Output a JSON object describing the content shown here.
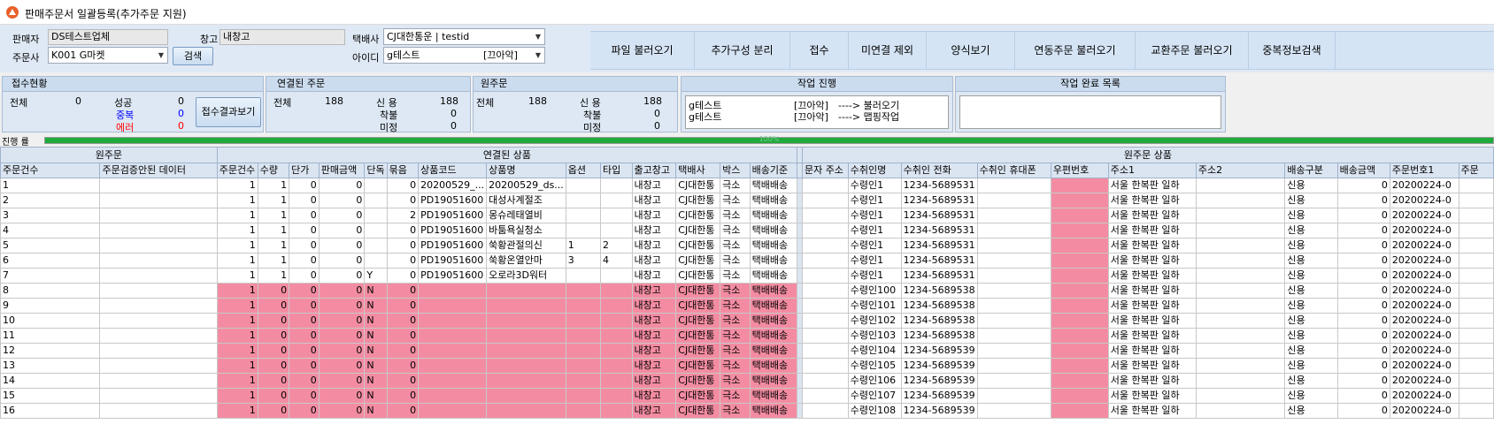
{
  "window": {
    "title": "판매주문서 일괄등록(추가주문 지원)"
  },
  "filters": {
    "seller_label": "판매자",
    "seller_value": "DS테스트업체",
    "warehouse_label": "창고",
    "warehouse_value": "내창고",
    "courier_label": "택배사",
    "courier_value": "CJ대한통운 | testid",
    "orderer_label": "주문사",
    "orderer_value": "K001 G마켓",
    "search_button": "검색",
    "id_label": "아이디",
    "id_value": "g테스트",
    "id_value_tag": "[끄아악]"
  },
  "toolbar": [
    "파일 불러오기",
    "추가구성 분리",
    "접수",
    "미연결 제외",
    "양식보기",
    "연동주문 불러오기",
    "교환주문 불러오기",
    "중복정보검색"
  ],
  "receipt": {
    "title": "접수현황",
    "total_label": "전체",
    "total": "0",
    "success_label": "성공",
    "success": "0",
    "dup_label": "중복",
    "dup": "0",
    "error_label": "에러",
    "error": "0",
    "button": "접수결과보기"
  },
  "linked": {
    "title": "연결된 주문",
    "total_label": "전체",
    "total": "188",
    "credit_label": "신 용",
    "credit": "188",
    "cod_label": "착불",
    "cod": "0",
    "undecided_label": "미정",
    "undecided": "0"
  },
  "original": {
    "title": "원주문",
    "total_label": "전체",
    "total": "188",
    "credit_label": "신 용",
    "credit": "188",
    "cod_label": "착불",
    "cod": "0",
    "undecided_label": "미정",
    "undecided": "0"
  },
  "progress_panel": {
    "title": "작업 진행",
    "lines": [
      {
        "name": "g테스트",
        "tag": "[끄아악]",
        "action": "----> 불러오기"
      },
      {
        "name": "g테스트",
        "tag": "[끄아악]",
        "action": "----> 맵핑작업"
      }
    ]
  },
  "done_panel": {
    "title": "작업 완료 목록"
  },
  "progress": {
    "label": "진행 률",
    "percent": 100,
    "text": "100%"
  },
  "colors": {
    "error_row": "#f38ca2",
    "header": "#dbe5f1",
    "progress": "#1faa3c",
    "dup": "#0000ff",
    "error": "#ff0000"
  },
  "grid": {
    "groups": {
      "original": "원주문",
      "linked": "연결된 상품",
      "original_product": "원주문 상품"
    },
    "left_headers": [
      "주문건수",
      "주문검증안된 데이터"
    ],
    "mid_headers": [
      "주문건수",
      "수량",
      "단가",
      "판매금액",
      "단독",
      "묶음",
      "상품코드",
      "상품명",
      "옵션",
      "타입",
      "출고창고",
      "택배사",
      "박스",
      "배송기준"
    ],
    "right_headers": [
      "문자 주소",
      "수취인명",
      "수취인 전화",
      "수취인 휴대폰",
      "우편번호",
      "주소1",
      "주소2",
      "배송구분",
      "배송금액",
      "주문번호1",
      "주문"
    ],
    "rows": [
      {
        "no": "1",
        "m": [
          "1",
          "1",
          "0",
          "0",
          "",
          "0",
          "20200529_...",
          "20200529_ds...",
          "",
          "",
          "내창고",
          "CJ대한통",
          "극소",
          "택배배송"
        ],
        "r": [
          "",
          "수령인1",
          "1234-5689531",
          "",
          "",
          "서울 한복판 일하",
          "",
          "신용",
          "0",
          "20200224-0",
          ""
        ],
        "err": false
      },
      {
        "no": "2",
        "m": [
          "1",
          "1",
          "0",
          "0",
          "",
          "0",
          "PD19051600",
          "대성사계절조",
          "",
          "",
          "내창고",
          "CJ대한통",
          "극소",
          "택배배송"
        ],
        "r": [
          "",
          "수령인1",
          "1234-5689531",
          "",
          "",
          "서울 한복판 일하",
          "",
          "신용",
          "0",
          "20200224-0",
          ""
        ],
        "err": false
      },
      {
        "no": "3",
        "m": [
          "1",
          "1",
          "0",
          "0",
          "",
          "2",
          "PD19051600",
          "몽슈레태열비",
          "",
          "",
          "내창고",
          "CJ대한통",
          "극소",
          "택배배송"
        ],
        "r": [
          "",
          "수령인1",
          "1234-5689531",
          "",
          "",
          "서울 한복판 일하",
          "",
          "신용",
          "0",
          "20200224-0",
          ""
        ],
        "err": false
      },
      {
        "no": "4",
        "m": [
          "1",
          "1",
          "0",
          "0",
          "",
          "0",
          "PD19051600",
          "바툼욕실청소",
          "",
          "",
          "내창고",
          "CJ대한통",
          "극소",
          "택배배송"
        ],
        "r": [
          "",
          "수령인1",
          "1234-5689531",
          "",
          "",
          "서울 한복판 일하",
          "",
          "신용",
          "0",
          "20200224-0",
          ""
        ],
        "err": false
      },
      {
        "no": "5",
        "m": [
          "1",
          "1",
          "0",
          "0",
          "",
          "0",
          "PD19051600",
          "쑥황관절의신",
          "1",
          "2",
          "내창고",
          "CJ대한통",
          "극소",
          "택배배송"
        ],
        "r": [
          "",
          "수령인1",
          "1234-5689531",
          "",
          "",
          "서울 한복판 일하",
          "",
          "신용",
          "0",
          "20200224-0",
          ""
        ],
        "err": false
      },
      {
        "no": "6",
        "m": [
          "1",
          "1",
          "0",
          "0",
          "",
          "0",
          "PD19051600",
          "쑥황온열안마",
          "3",
          "4",
          "내창고",
          "CJ대한통",
          "극소",
          "택배배송"
        ],
        "r": [
          "",
          "수령인1",
          "1234-5689531",
          "",
          "",
          "서울 한복판 일하",
          "",
          "신용",
          "0",
          "20200224-0",
          ""
        ],
        "err": false
      },
      {
        "no": "7",
        "m": [
          "1",
          "1",
          "0",
          "0",
          "Y",
          "0",
          "PD19051600",
          "오로라3D워터",
          "",
          "",
          "내창고",
          "CJ대한통",
          "극소",
          "택배배송"
        ],
        "r": [
          "",
          "수령인1",
          "1234-5689531",
          "",
          "",
          "서울 한복판 일하",
          "",
          "신용",
          "0",
          "20200224-0",
          ""
        ],
        "err": false
      },
      {
        "no": "8",
        "m": [
          "1",
          "0",
          "0",
          "0",
          "N",
          "0",
          "",
          "",
          "",
          "",
          "내창고",
          "CJ대한통",
          "극소",
          "택배배송"
        ],
        "r": [
          "",
          "수령인100",
          "1234-5689538",
          "",
          "",
          "서울 한복판 일하",
          "",
          "신용",
          "0",
          "20200224-0",
          ""
        ],
        "err": true
      },
      {
        "no": "9",
        "m": [
          "1",
          "0",
          "0",
          "0",
          "N",
          "0",
          "",
          "",
          "",
          "",
          "내창고",
          "CJ대한통",
          "극소",
          "택배배송"
        ],
        "r": [
          "",
          "수령인101",
          "1234-5689538",
          "",
          "",
          "서울 한복판 일하",
          "",
          "신용",
          "0",
          "20200224-0",
          ""
        ],
        "err": true
      },
      {
        "no": "10",
        "m": [
          "1",
          "0",
          "0",
          "0",
          "N",
          "0",
          "",
          "",
          "",
          "",
          "내창고",
          "CJ대한통",
          "극소",
          "택배배송"
        ],
        "r": [
          "",
          "수령인102",
          "1234-5689538",
          "",
          "",
          "서울 한복판 일하",
          "",
          "신용",
          "0",
          "20200224-0",
          ""
        ],
        "err": true
      },
      {
        "no": "11",
        "m": [
          "1",
          "0",
          "0",
          "0",
          "N",
          "0",
          "",
          "",
          "",
          "",
          "내창고",
          "CJ대한통",
          "극소",
          "택배배송"
        ],
        "r": [
          "",
          "수령인103",
          "1234-5689538",
          "",
          "",
          "서울 한복판 일하",
          "",
          "신용",
          "0",
          "20200224-0",
          ""
        ],
        "err": true
      },
      {
        "no": "12",
        "m": [
          "1",
          "0",
          "0",
          "0",
          "N",
          "0",
          "",
          "",
          "",
          "",
          "내창고",
          "CJ대한통",
          "극소",
          "택배배송"
        ],
        "r": [
          "",
          "수령인104",
          "1234-5689539",
          "",
          "",
          "서울 한복판 일하",
          "",
          "신용",
          "0",
          "20200224-0",
          ""
        ],
        "err": true
      },
      {
        "no": "13",
        "m": [
          "1",
          "0",
          "0",
          "0",
          "N",
          "0",
          "",
          "",
          "",
          "",
          "내창고",
          "CJ대한통",
          "극소",
          "택배배송"
        ],
        "r": [
          "",
          "수령인105",
          "1234-5689539",
          "",
          "",
          "서울 한복판 일하",
          "",
          "신용",
          "0",
          "20200224-0",
          ""
        ],
        "err": true
      },
      {
        "no": "14",
        "m": [
          "1",
          "0",
          "0",
          "0",
          "N",
          "0",
          "",
          "",
          "",
          "",
          "내창고",
          "CJ대한통",
          "극소",
          "택배배송"
        ],
        "r": [
          "",
          "수령인106",
          "1234-5689539",
          "",
          "",
          "서울 한복판 일하",
          "",
          "신용",
          "0",
          "20200224-0",
          ""
        ],
        "err": true
      },
      {
        "no": "15",
        "m": [
          "1",
          "0",
          "0",
          "0",
          "N",
          "0",
          "",
          "",
          "",
          "",
          "내창고",
          "CJ대한통",
          "극소",
          "택배배송"
        ],
        "r": [
          "",
          "수령인107",
          "1234-5689539",
          "",
          "",
          "서울 한복판 일하",
          "",
          "신용",
          "0",
          "20200224-0",
          ""
        ],
        "err": true
      },
      {
        "no": "16",
        "m": [
          "1",
          "0",
          "0",
          "0",
          "N",
          "0",
          "",
          "",
          "",
          "",
          "내창고",
          "CJ대한통",
          "극소",
          "택배배송"
        ],
        "r": [
          "",
          "수령인108",
          "1234-5689539",
          "",
          "",
          "서울 한복판 일하",
          "",
          "신용",
          "0",
          "20200224-0",
          ""
        ],
        "err": true
      }
    ]
  }
}
